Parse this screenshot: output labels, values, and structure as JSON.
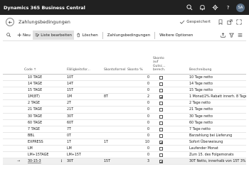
{
  "app": {
    "name": "Dynamics 365 Business Central",
    "avatar_initials": "SA"
  },
  "page": {
    "title": "Zahlungsbedingungen",
    "saved_label": "Gespeichert"
  },
  "actions": {
    "new": "Neu",
    "edit_list": "Liste bearbeiten",
    "delete": "Löschen",
    "payment_terms": "Zahlungsbedingungen",
    "more_options": "Weitere Optionen"
  },
  "columns": {
    "code": "Code",
    "code_sort": "↑",
    "due_date_formula": "Fälligkeitsfor...",
    "discount_formula": "Skontoformel",
    "discount_pct": "Skonto %",
    "calc_pmt_disc_line1": "Skonto",
    "calc_pmt_disc_line2": "auf",
    "calc_pmt_disc_line3": "Gutsc...",
    "calc_pmt_disc_line4": "berech.",
    "description": "Beschreibung"
  },
  "rows": [
    {
      "code": "10 TAGE",
      "due": "10T",
      "disc_formula": "",
      "disc_pct": "0",
      "calc": false,
      "desc": "10 Tage netto",
      "selected": false,
      "current": false
    },
    {
      "code": "14 TAGE",
      "due": "14T",
      "disc_formula": "",
      "disc_pct": "0",
      "calc": false,
      "desc": "14 Tage netto",
      "selected": false,
      "current": false
    },
    {
      "code": "15 TAGE",
      "due": "15T",
      "disc_formula": "",
      "disc_pct": "0",
      "calc": false,
      "desc": "15 Tage netto",
      "selected": false,
      "current": false
    },
    {
      "code": "1M(8T)",
      "due": "1M",
      "disc_formula": "8T",
      "disc_pct": "2",
      "calc": true,
      "desc": "1 Monat/2% Rabatt innerh. 8 Tagen",
      "selected": false,
      "current": false
    },
    {
      "code": "2 TAGE",
      "due": "2T",
      "disc_formula": "",
      "disc_pct": "0",
      "calc": false,
      "desc": "2 Tage netto",
      "selected": false,
      "current": false
    },
    {
      "code": "21 TAGE",
      "due": "21T",
      "disc_formula": "",
      "disc_pct": "0",
      "calc": false,
      "desc": "21 Tage netto",
      "selected": false,
      "current": false
    },
    {
      "code": "30 TAGE",
      "due": "30T",
      "disc_formula": "",
      "disc_pct": "0",
      "calc": false,
      "desc": "30 Tage netto",
      "selected": false,
      "current": false
    },
    {
      "code": "60 TAGE",
      "due": "60T",
      "disc_formula": "",
      "disc_pct": "0",
      "calc": false,
      "desc": "60 Tage netto",
      "selected": false,
      "current": false
    },
    {
      "code": "7 TAGE",
      "due": "7T",
      "disc_formula": "",
      "disc_pct": "0",
      "calc": false,
      "desc": "7 Tage netto",
      "selected": false,
      "current": false
    },
    {
      "code": "BBL",
      "due": "0T",
      "disc_formula": "",
      "disc_pct": "0",
      "calc": false,
      "desc": "Barzahlung bei Lieferung",
      "selected": false,
      "current": false
    },
    {
      "code": "EXPRESS",
      "due": "1T",
      "disc_formula": "1T",
      "disc_pct": "10",
      "calc": true,
      "desc": "Sofort Überweisung",
      "selected": false,
      "current": false
    },
    {
      "code": "LM",
      "due": "LM",
      "disc_formula": "",
      "disc_pct": "0",
      "calc": false,
      "desc": "Laufender Monat",
      "selected": false,
      "current": false
    },
    {
      "code": "LM+15TAGE",
      "due": "LM+15T",
      "disc_formula": "",
      "disc_pct": "0",
      "calc": false,
      "desc": "Zum 15. des Folgemonats",
      "selected": false,
      "current": false
    },
    {
      "code": "30-15-3",
      "due": "30T",
      "disc_formula": "15T",
      "disc_pct": "3",
      "calc": true,
      "desc": "30T Netto, innerhalb von 15T 3% Sk...",
      "selected": true,
      "current": true
    }
  ],
  "colors": {
    "suitebar": "#212121",
    "accent": "#0078d4"
  }
}
